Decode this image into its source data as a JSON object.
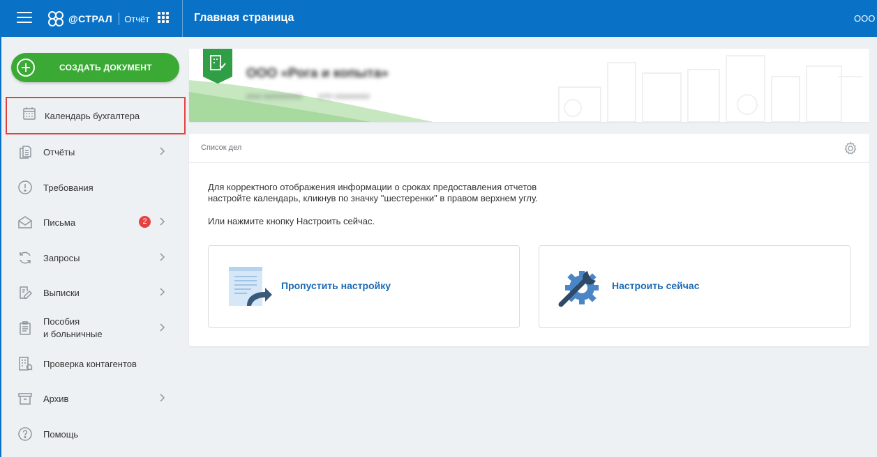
{
  "header": {
    "brand": "@СТРАЛ",
    "product": "Отчёт",
    "page_title": "Главная страница",
    "org_short": "ООО «"
  },
  "colors": {
    "primary": "#0a72c6",
    "accent_green": "#3aaa35",
    "badge_red": "#e5413f",
    "link_blue": "#1b6ab4"
  },
  "sidebar": {
    "create_button": "СОЗДАТЬ ДОКУМЕНТ",
    "items": [
      {
        "label": "Календарь бухгалтера",
        "icon": "calendar-icon",
        "active": true
      },
      {
        "label": "Отчёты",
        "icon": "documents-icon",
        "has_submenu": true
      },
      {
        "label": "Требования",
        "icon": "alert-circle-icon"
      },
      {
        "label": "Письма",
        "icon": "envelope-icon",
        "badge": "2",
        "has_submenu": true
      },
      {
        "label": "Запросы",
        "icon": "refresh-icon",
        "has_submenu": true
      },
      {
        "label": "Выписки",
        "icon": "edit-document-icon",
        "has_submenu": true
      },
      {
        "label_line1": "Пособия",
        "label_line2": "и больничные",
        "icon": "clipboard-icon",
        "has_submenu": true
      },
      {
        "label": "Проверка контагентов",
        "icon": "building-check-icon"
      },
      {
        "label": "Архив",
        "icon": "archive-icon",
        "has_submenu": true
      },
      {
        "label": "Помощь",
        "icon": "help-icon"
      }
    ]
  },
  "company": {
    "name": "ООО «Рога и копыта»",
    "inn": "ИНН 0000000000",
    "kpp": "КПП 000000000"
  },
  "tasks": {
    "title": "Список дел",
    "text_line1": "Для корректного отображения информации о сроках предоставления отчетов",
    "text_line2": "настройте календарь, кликнув по значку \"шестеренки\" в правом верхнем углу.",
    "text_line3": "Или нажмите кнопку Настроить сейчас.",
    "skip_label": "Пропустить настройку",
    "setup_label": "Настроить сейчас"
  }
}
